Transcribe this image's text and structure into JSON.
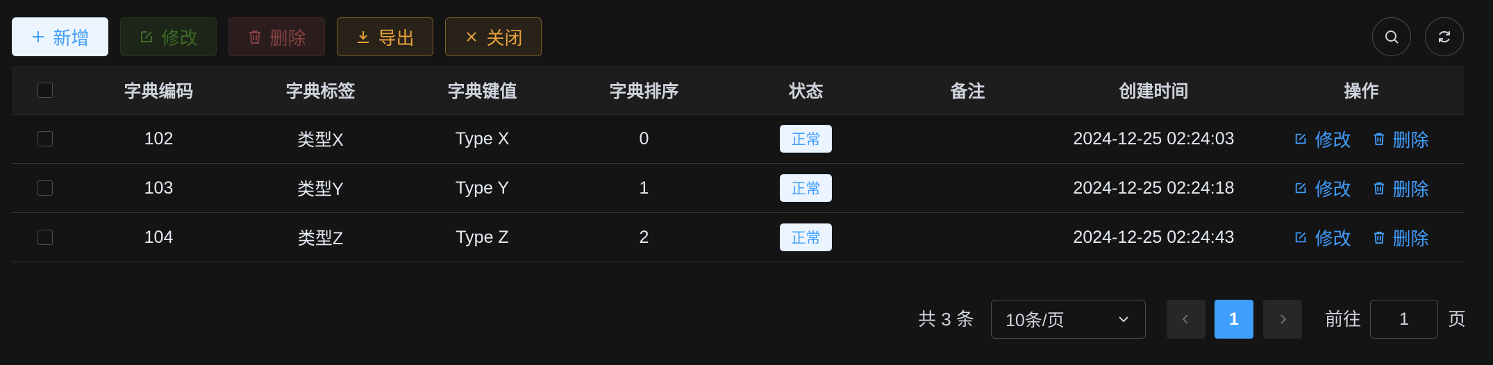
{
  "toolbar": {
    "add_label": "新增",
    "edit_label": "修改",
    "delete_label": "删除",
    "export_label": "导出",
    "close_label": "关闭"
  },
  "table": {
    "headers": [
      "字典编码",
      "字典标签",
      "字典键值",
      "字典排序",
      "状态",
      "备注",
      "创建时间",
      "操作"
    ],
    "rows": [
      {
        "code": "102",
        "label": "类型X",
        "value": "Type X",
        "sort": "0",
        "status": "正常",
        "remark": "",
        "created": "2024-12-25 02:24:03"
      },
      {
        "code": "103",
        "label": "类型Y",
        "value": "Type Y",
        "sort": "1",
        "status": "正常",
        "remark": "",
        "created": "2024-12-25 02:24:18"
      },
      {
        "code": "104",
        "label": "类型Z",
        "value": "Type Z",
        "sort": "2",
        "status": "正常",
        "remark": "",
        "created": "2024-12-25 02:24:43"
      }
    ],
    "op_edit": "修改",
    "op_delete": "删除"
  },
  "pagination": {
    "total": "共 3 条",
    "page_size": "10条/页",
    "current_page": "1",
    "goto_label": "前往",
    "goto_value": "1",
    "page_unit": "页"
  },
  "colors": {
    "primary": "#409eff",
    "success": "#67c23a",
    "danger": "#f56c6c",
    "warning": "#e6a23c",
    "background": "#141414"
  },
  "icons": [
    "plus-icon",
    "edit-icon",
    "delete-icon",
    "download-icon",
    "close-icon",
    "search-icon",
    "refresh-icon",
    "chevron-down-icon",
    "chevron-left-icon",
    "chevron-right-icon"
  ]
}
